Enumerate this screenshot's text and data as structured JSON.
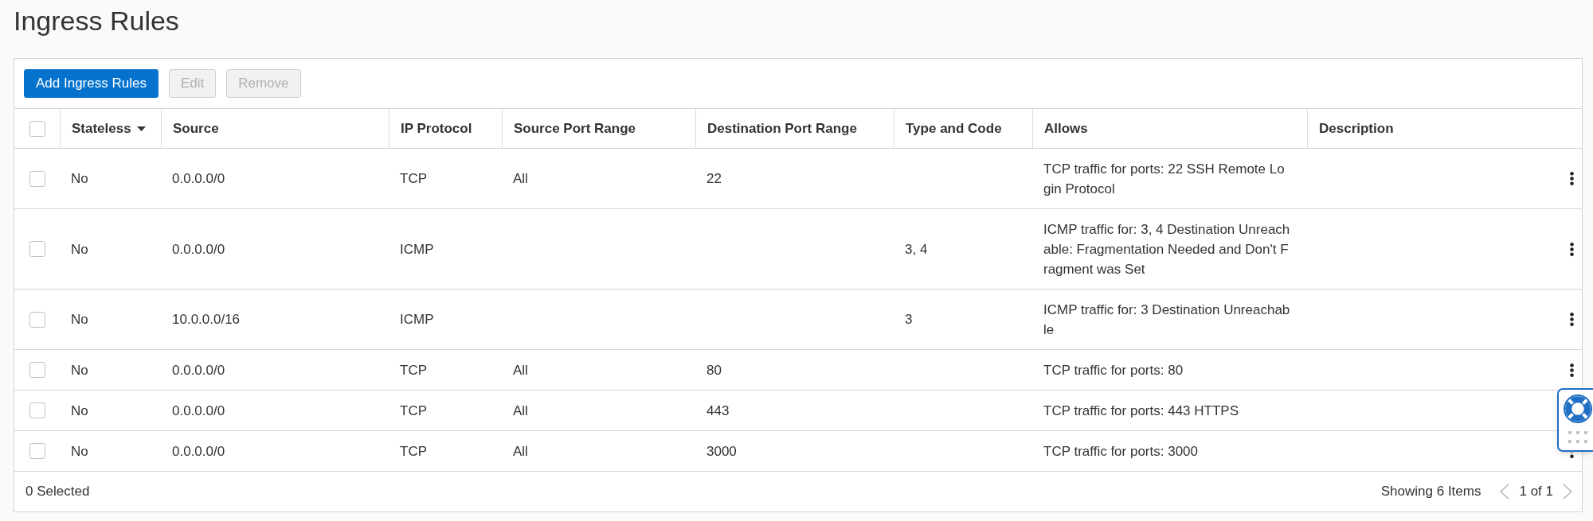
{
  "page": {
    "title": "Ingress Rules"
  },
  "toolbar": {
    "buttons": [
      {
        "label": "Add Ingress Rules",
        "primary": true,
        "disabled": false
      },
      {
        "label": "Edit",
        "primary": false,
        "disabled": true
      },
      {
        "label": "Remove",
        "primary": false,
        "disabled": true
      }
    ]
  },
  "table": {
    "select_all": {
      "checked": false
    },
    "columns": [
      {
        "label": "Stateless",
        "sorted": true
      },
      {
        "label": "Source",
        "sorted": false
      },
      {
        "label": "IP Protocol",
        "sorted": false
      },
      {
        "label": "Source Port Range",
        "sorted": false
      },
      {
        "label": "Destination Port Range",
        "sorted": false
      },
      {
        "label": "Type and Code",
        "sorted": false
      },
      {
        "label": "Allows",
        "sorted": false
      },
      {
        "label": "Description",
        "sorted": false
      }
    ],
    "rows": [
      {
        "checked": false,
        "stateless": "No",
        "source": "0.0.0.0/0",
        "ip_protocol": "TCP",
        "source_port_range": "All",
        "destination_port_range": "22",
        "allows": "TCP traffic for ports: 22 SSH Remote Login Protocol"
      },
      {
        "checked": false,
        "stateless": "No",
        "source": "0.0.0.0/0",
        "ip_protocol": "ICMP",
        "type_and_code": "3, 4",
        "allows": "ICMP traffic for: 3, 4 Destination Unreachable: Fragmentation Needed and Don't Fragment was Set"
      },
      {
        "checked": false,
        "stateless": "No",
        "source": "10.0.0.0/16",
        "ip_protocol": "ICMP",
        "type_and_code": "3",
        "allows": "ICMP traffic for: 3 Destination Unreachable"
      },
      {
        "checked": false,
        "stateless": "No",
        "source": "0.0.0.0/0",
        "ip_protocol": "TCP",
        "source_port_range": "All",
        "destination_port_range": "80",
        "allows": "TCP traffic for ports: 80"
      },
      {
        "checked": false,
        "stateless": "No",
        "source": "0.0.0.0/0",
        "ip_protocol": "TCP",
        "source_port_range": "All",
        "destination_port_range": "443",
        "allows": "TCP traffic for ports: 443 HTTPS"
      },
      {
        "checked": false,
        "stateless": "No",
        "source": "0.0.0.0/0",
        "ip_protocol": "TCP",
        "source_port_range": "All",
        "destination_port_range": "3000",
        "allows": "TCP traffic for ports: 3000"
      }
    ]
  },
  "footer": {
    "selected": "0 Selected",
    "showing": "Showing 6 Items",
    "page": "1 of 1"
  }
}
